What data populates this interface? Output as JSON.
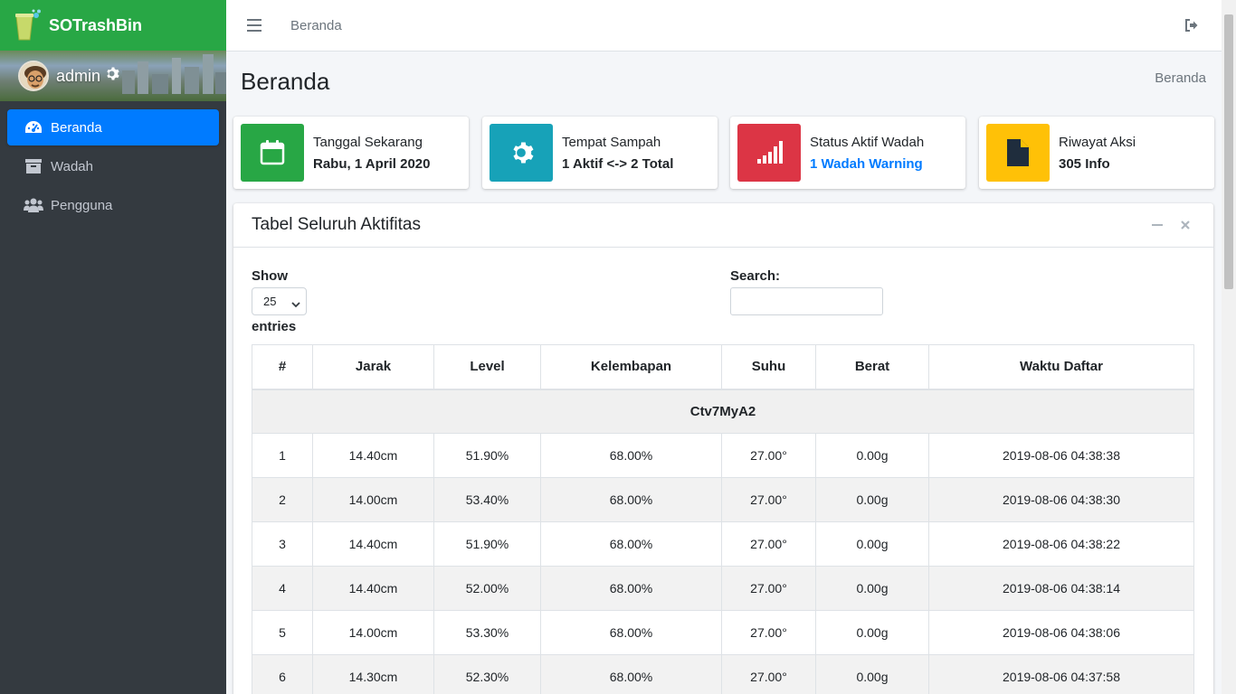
{
  "brand": {
    "name": "SOTrashBin"
  },
  "user": {
    "name": "admin"
  },
  "sidebar": {
    "items": [
      {
        "label": "Beranda",
        "icon": "dashboard-icon",
        "active": true
      },
      {
        "label": "Wadah",
        "icon": "archive-icon",
        "active": false
      },
      {
        "label": "Pengguna",
        "icon": "users-icon",
        "active": false
      }
    ]
  },
  "topbar": {
    "link": "Beranda"
  },
  "page": {
    "title": "Beranda",
    "breadcrumb": "Beranda"
  },
  "info_boxes": [
    {
      "label": "Tanggal Sekarang",
      "value": "Rabu, 1 April 2020",
      "color": "#28a745",
      "icon": "calendar-icon"
    },
    {
      "label": "Tempat Sampah",
      "value": "1 Aktif <-> 2 Total",
      "color": "#17a2b8",
      "icon": "gear-icon"
    },
    {
      "label": "Status Aktif Wadah",
      "value": "1 Wadah Warning",
      "color": "#dc3545",
      "icon": "signal-icon",
      "value_color": "#007bff"
    },
    {
      "label": "Riwayat Aksi",
      "value": "305 Info",
      "color": "#ffc107",
      "icon": "file-icon"
    }
  ],
  "card": {
    "title": "Tabel Seluruh Aktifitas",
    "show_label": "Show",
    "page_length": "25",
    "entries_label": "entries",
    "search_label": "Search:",
    "search_value": ""
  },
  "table": {
    "columns": [
      "#",
      "Jarak",
      "Level",
      "Kelembapan",
      "Suhu",
      "Berat",
      "Waktu Daftar"
    ],
    "group": "Ctv7MyA2",
    "rows": [
      [
        "1",
        "14.40cm",
        "51.90%",
        "68.00%",
        "27.00°",
        "0.00g",
        "2019-08-06 04:38:38"
      ],
      [
        "2",
        "14.00cm",
        "53.40%",
        "68.00%",
        "27.00°",
        "0.00g",
        "2019-08-06 04:38:30"
      ],
      [
        "3",
        "14.40cm",
        "51.90%",
        "68.00%",
        "27.00°",
        "0.00g",
        "2019-08-06 04:38:22"
      ],
      [
        "4",
        "14.40cm",
        "52.00%",
        "68.00%",
        "27.00°",
        "0.00g",
        "2019-08-06 04:38:14"
      ],
      [
        "5",
        "14.00cm",
        "53.30%",
        "68.00%",
        "27.00°",
        "0.00g",
        "2019-08-06 04:38:06"
      ],
      [
        "6",
        "14.30cm",
        "52.30%",
        "68.00%",
        "27.00°",
        "0.00g",
        "2019-08-06 04:37:58"
      ]
    ]
  },
  "colors": {
    "primary": "#007bff",
    "success": "#28a745",
    "sidebar_bg": "#343a40"
  }
}
